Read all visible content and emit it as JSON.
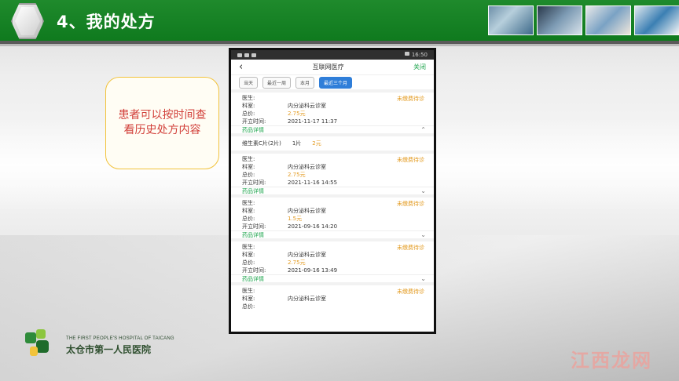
{
  "header": {
    "title": "4、我的处方",
    "colors": {
      "bar": "#128020",
      "accent": "#5a5a5a"
    }
  },
  "callout": {
    "text": "患者可以按时间查看历史处方内容",
    "border_color": "#f2c33b",
    "text_color": "#d2403a"
  },
  "phone": {
    "statusbar": {
      "time": "16:50"
    },
    "navbar": {
      "title": "互联网医疗",
      "close_label": "关闭",
      "back_icon": "chevron-left-icon"
    },
    "filters": [
      {
        "label": "当天",
        "active": false
      },
      {
        "label": "最近一周",
        "active": false
      },
      {
        "label": "本月",
        "active": false
      },
      {
        "label": "最近三个月",
        "active": true
      }
    ],
    "record_labels": {
      "doctor": "医生:",
      "dept": "科室:",
      "total": "总价:",
      "time": "开立时间:"
    },
    "detail_title": "药品详情",
    "records": [
      {
        "status": "未缴费待诊",
        "dept": "内分泌科云诊室",
        "total": "2.75元",
        "time": "2021-11-17 11:37",
        "expanded": true,
        "drug": {
          "name": "维生素C片(2片)",
          "qty": "1片",
          "price": "2元"
        }
      },
      {
        "status": "未缴费待诊",
        "dept": "内分泌科云诊室",
        "total": "2.75元",
        "time": "2021-11-16 14:55",
        "expanded": false
      },
      {
        "status": "未缴费待诊",
        "dept": "内分泌科云诊室",
        "total": "1.5元",
        "time": "2021-09-16 14:20",
        "expanded": false
      },
      {
        "status": "未缴费待诊",
        "dept": "内分泌科云诊室",
        "total": "2.75元",
        "time": "2021-09-16 13:49",
        "expanded": false
      },
      {
        "status": "未缴费待诊",
        "dept": "内分泌科云诊室",
        "total": "",
        "time": "",
        "expanded": false
      }
    ]
  },
  "footer": {
    "logo_en": "THE FIRST PEOPLE'S HOSPITAL OF TAICANG",
    "logo_cn": "太仓市第一人民医院"
  },
  "watermark": "江西龙网"
}
